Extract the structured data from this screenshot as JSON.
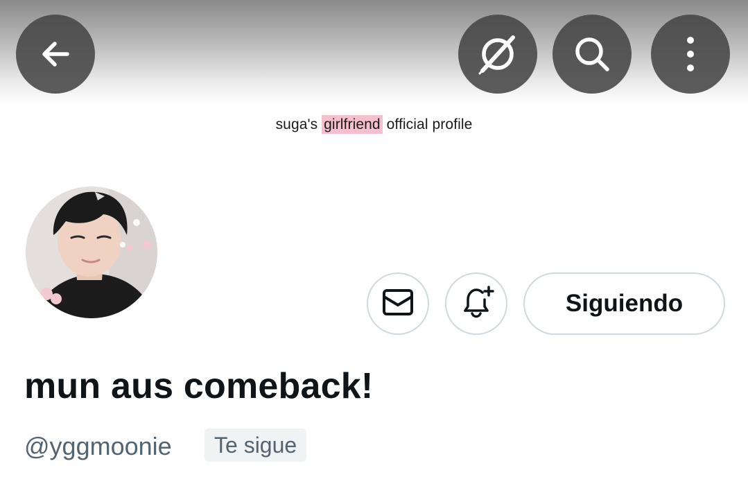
{
  "header": {
    "caption_before": "suga's",
    "caption_highlight": "girlfriend",
    "caption_after": "official profile",
    "highlight_color": "#f5bfcf",
    "buttons": [
      {
        "icon": "back-arrow-icon"
      },
      {
        "icon": "grok-icon"
      },
      {
        "icon": "search-icon"
      },
      {
        "icon": "more-vertical-icon"
      }
    ]
  },
  "profile": {
    "avatar_icon": "profile-photo",
    "actions": {
      "message_icon": "mail-icon",
      "notify_icon": "bell-plus-icon",
      "follow_label": "Siguiendo"
    },
    "display_name": "mun aus comeback!",
    "handle": "@yggmoonie",
    "follows_you_label": "Te sigue"
  },
  "colors": {
    "text_primary": "#0f1419",
    "text_secondary": "#536471",
    "border": "#cfd9de",
    "badge_bg": "#eff3f4"
  }
}
